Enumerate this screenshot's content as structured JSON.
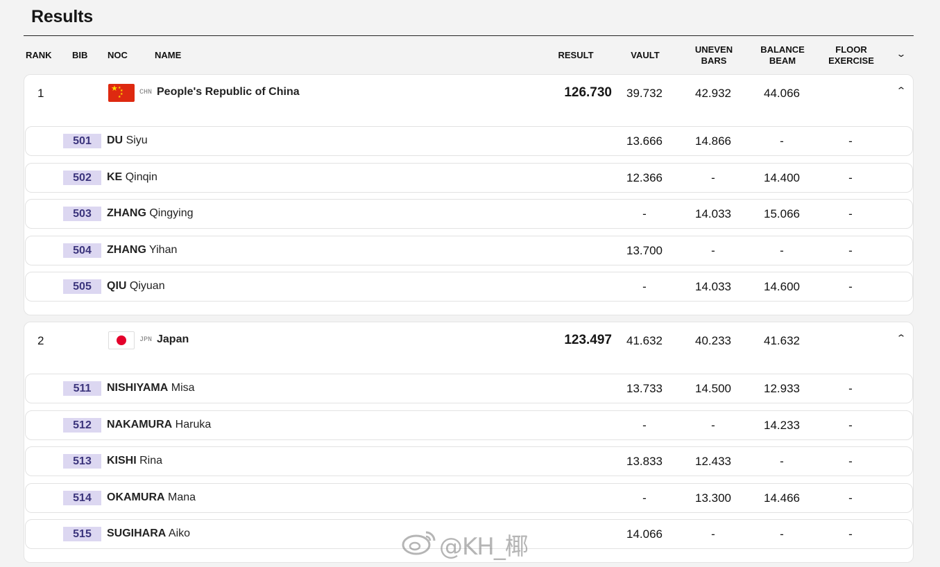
{
  "page_title": "Results",
  "columns": {
    "rank": "RANK",
    "bib": "BIB",
    "noc": "NOC",
    "name": "NAME",
    "result": "RESULT",
    "vault": "VAULT",
    "uneven_l1": "UNEVEN",
    "uneven_l2": "BARS",
    "beam_l1": "BALANCE",
    "beam_l2": "BEAM",
    "floor_l1": "FLOOR",
    "floor_l2": "EXERCISE"
  },
  "teams": [
    {
      "rank": "1",
      "noc": "CHN",
      "name": "People's Republic of China",
      "result": "126.730",
      "vault": "39.732",
      "uneven_bars": "42.932",
      "balance_beam": "44.066",
      "floor": "",
      "athletes": [
        {
          "bib": "501",
          "last": "DU",
          "first": "Siyu",
          "vault": "13.666",
          "uneven_bars": "14.866",
          "balance_beam": "-",
          "floor": "-"
        },
        {
          "bib": "502",
          "last": "KE",
          "first": "Qinqin",
          "vault": "12.366",
          "uneven_bars": "-",
          "balance_beam": "14.400",
          "floor": "-"
        },
        {
          "bib": "503",
          "last": "ZHANG",
          "first": "Qingying",
          "vault": "-",
          "uneven_bars": "14.033",
          "balance_beam": "15.066",
          "floor": "-"
        },
        {
          "bib": "504",
          "last": "ZHANG",
          "first": "Yihan",
          "vault": "13.700",
          "uneven_bars": "-",
          "balance_beam": "-",
          "floor": "-"
        },
        {
          "bib": "505",
          "last": "QIU",
          "first": "Qiyuan",
          "vault": "-",
          "uneven_bars": "14.033",
          "balance_beam": "14.600",
          "floor": "-"
        }
      ]
    },
    {
      "rank": "2",
      "noc": "JPN",
      "name": "Japan",
      "result": "123.497",
      "vault": "41.632",
      "uneven_bars": "40.233",
      "balance_beam": "41.632",
      "floor": "",
      "athletes": [
        {
          "bib": "511",
          "last": "NISHIYAMA",
          "first": "Misa",
          "vault": "13.733",
          "uneven_bars": "14.500",
          "balance_beam": "12.933",
          "floor": "-"
        },
        {
          "bib": "512",
          "last": "NAKAMURA",
          "first": "Haruka",
          "vault": "-",
          "uneven_bars": "-",
          "balance_beam": "14.233",
          "floor": "-"
        },
        {
          "bib": "513",
          "last": "KISHI",
          "first": "Rina",
          "vault": "13.833",
          "uneven_bars": "12.433",
          "balance_beam": "-",
          "floor": "-"
        },
        {
          "bib": "514",
          "last": "OKAMURA",
          "first": "Mana",
          "vault": "-",
          "uneven_bars": "13.300",
          "balance_beam": "14.466",
          "floor": "-"
        },
        {
          "bib": "515",
          "last": "SUGIHARA",
          "first": "Aiko",
          "vault": "14.066",
          "uneven_bars": "-",
          "balance_beam": "-",
          "floor": "-"
        }
      ]
    }
  ],
  "watermark": "@KH_椰",
  "icons": {
    "collapse": "chevron-up-icon",
    "expand_all": "chevron-down-icon",
    "flag_chn": "china-flag-icon",
    "flag_jpn": "japan-flag-icon",
    "watermark_logo": "weibo-logo-icon"
  },
  "colors": {
    "bib_bg": "#dcd7f1",
    "bib_text": "#3b347c",
    "china_red": "#de2910",
    "japan_red": "#e4002b"
  }
}
